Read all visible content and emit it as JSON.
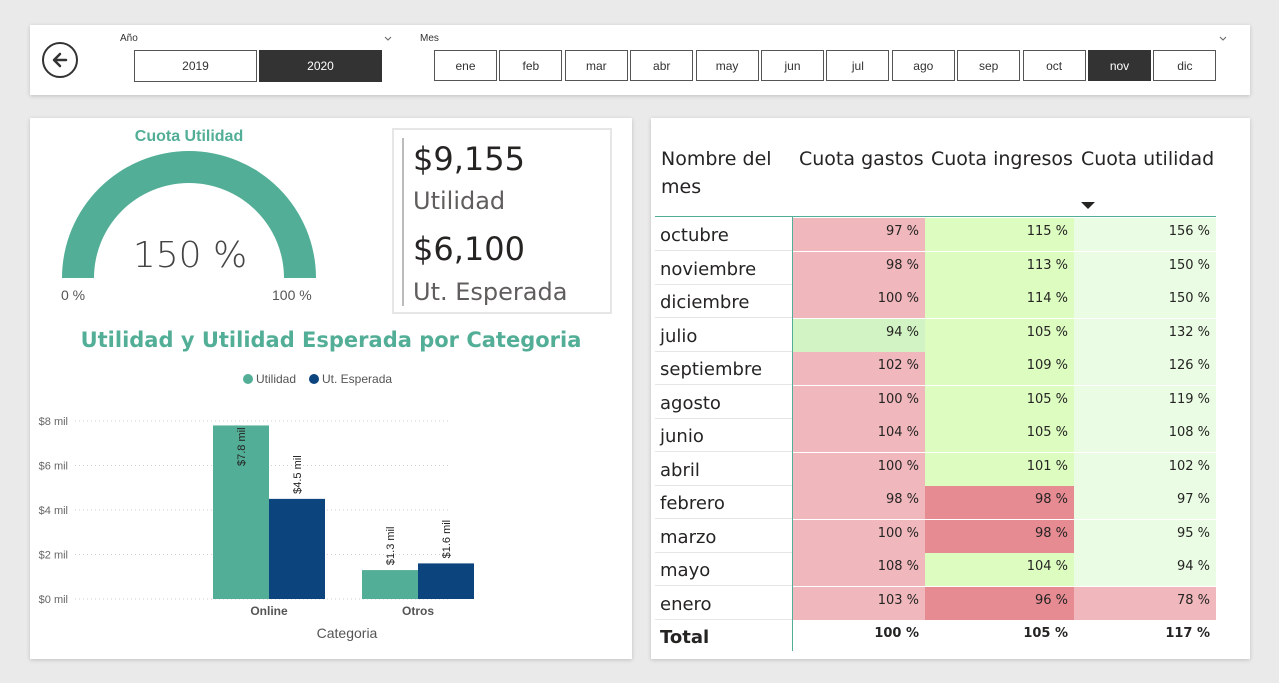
{
  "colors": {
    "accent": "#52ae96",
    "utilidad": "#52ae96",
    "esperada": "#0c447e",
    "selected_btn": "#333333",
    "heat_red_light": "#f0b8bc",
    "heat_red_dark": "#e78b93",
    "heat_green_light": "#ddfcc0",
    "heat_green_mid": "#d2f3c4",
    "heat_green_pale": "#eafde4"
  },
  "slicers": {
    "back_icon": "arrow-left-circle-icon",
    "year": {
      "title": "Año",
      "options": [
        "2019",
        "2020"
      ],
      "selected": "2020"
    },
    "month": {
      "title": "Mes",
      "options": [
        "ene",
        "feb",
        "mar",
        "abr",
        "may",
        "jun",
        "jul",
        "ago",
        "sep",
        "oct",
        "nov",
        "dic"
      ],
      "selected": "nov"
    }
  },
  "gauge": {
    "title": "Cuota Utilidad",
    "value_label": "150 %",
    "min_label": "0 %",
    "max_label": "100 %",
    "fill_fraction": 1.0
  },
  "card": {
    "amount1": "$9,155",
    "label1": "Utilidad",
    "amount2": "$6,100",
    "label2": "Ut. Esperada"
  },
  "chart": {
    "title": "Utilidad y Utilidad Esperada por Categoria",
    "legend": [
      "Utilidad",
      "Ut. Esperada"
    ],
    "xlabel": "Categoria"
  },
  "chart_data": {
    "type": "bar",
    "title": "Utilidad y Utilidad Esperada por Categoria",
    "xlabel": "Categoria",
    "ylabel": "",
    "categories": [
      "Online",
      "Otros"
    ],
    "series": [
      {
        "name": "Utilidad",
        "values": [
          7.8,
          1.3
        ],
        "labels": [
          "$7.8 mil",
          "$1.3 mil"
        ]
      },
      {
        "name": "Ut. Esperada",
        "values": [
          4.5,
          1.6
        ],
        "labels": [
          "$4.5 mil",
          "$1.6 mil"
        ]
      }
    ],
    "yticks": [
      0,
      2,
      4,
      6,
      8
    ],
    "ytick_labels": [
      "$0 mil",
      "$2 mil",
      "$4 mil",
      "$6 mil",
      "$8 mil"
    ],
    "ylim": [
      0,
      8
    ],
    "legend_position": "top-center",
    "grid": true
  },
  "table": {
    "headers": {
      "name": "Nombre del mes",
      "c1": "Cuota gastos",
      "c2": "Cuota ingresos",
      "c3": "Cuota utilidad"
    },
    "rows": [
      {
        "name": "octubre",
        "c1": "97 %",
        "c2": "115 %",
        "c3": "156 %",
        "k1": "red",
        "k2": "green",
        "k3": "pale"
      },
      {
        "name": "noviembre",
        "c1": "98 %",
        "c2": "113 %",
        "c3": "150 %",
        "k1": "red",
        "k2": "green",
        "k3": "pale"
      },
      {
        "name": "diciembre",
        "c1": "100 %",
        "c2": "114 %",
        "c3": "150 %",
        "k1": "red",
        "k2": "green",
        "k3": "pale"
      },
      {
        "name": "julio",
        "c1": "94 %",
        "c2": "105 %",
        "c3": "132 %",
        "k1": "gmid",
        "k2": "green",
        "k3": "pale"
      },
      {
        "name": "septiembre",
        "c1": "102 %",
        "c2": "109 %",
        "c3": "126 %",
        "k1": "red",
        "k2": "green",
        "k3": "pale"
      },
      {
        "name": "agosto",
        "c1": "100 %",
        "c2": "105 %",
        "c3": "119 %",
        "k1": "red",
        "k2": "green",
        "k3": "pale"
      },
      {
        "name": "junio",
        "c1": "104 %",
        "c2": "105 %",
        "c3": "108 %",
        "k1": "red",
        "k2": "green",
        "k3": "pale"
      },
      {
        "name": "abril",
        "c1": "100 %",
        "c2": "101 %",
        "c3": "102 %",
        "k1": "red",
        "k2": "green",
        "k3": "pale"
      },
      {
        "name": "febrero",
        "c1": "98 %",
        "c2": "98 %",
        "c3": "97 %",
        "k1": "red",
        "k2": "dred",
        "k3": "pale"
      },
      {
        "name": "marzo",
        "c1": "100 %",
        "c2": "98 %",
        "c3": "95 %",
        "k1": "red",
        "k2": "dred",
        "k3": "pale"
      },
      {
        "name": "mayo",
        "c1": "108 %",
        "c2": "104 %",
        "c3": "94 %",
        "k1": "red",
        "k2": "green",
        "k3": "pale"
      },
      {
        "name": "enero",
        "c1": "103 %",
        "c2": "96 %",
        "c3": "78 %",
        "k1": "red",
        "k2": "dred",
        "k3": "red"
      }
    ],
    "total": {
      "name": "Total",
      "c1": "100 %",
      "c2": "105 %",
      "c3": "117 %"
    },
    "sort_icon": "sort-descending-icon"
  }
}
